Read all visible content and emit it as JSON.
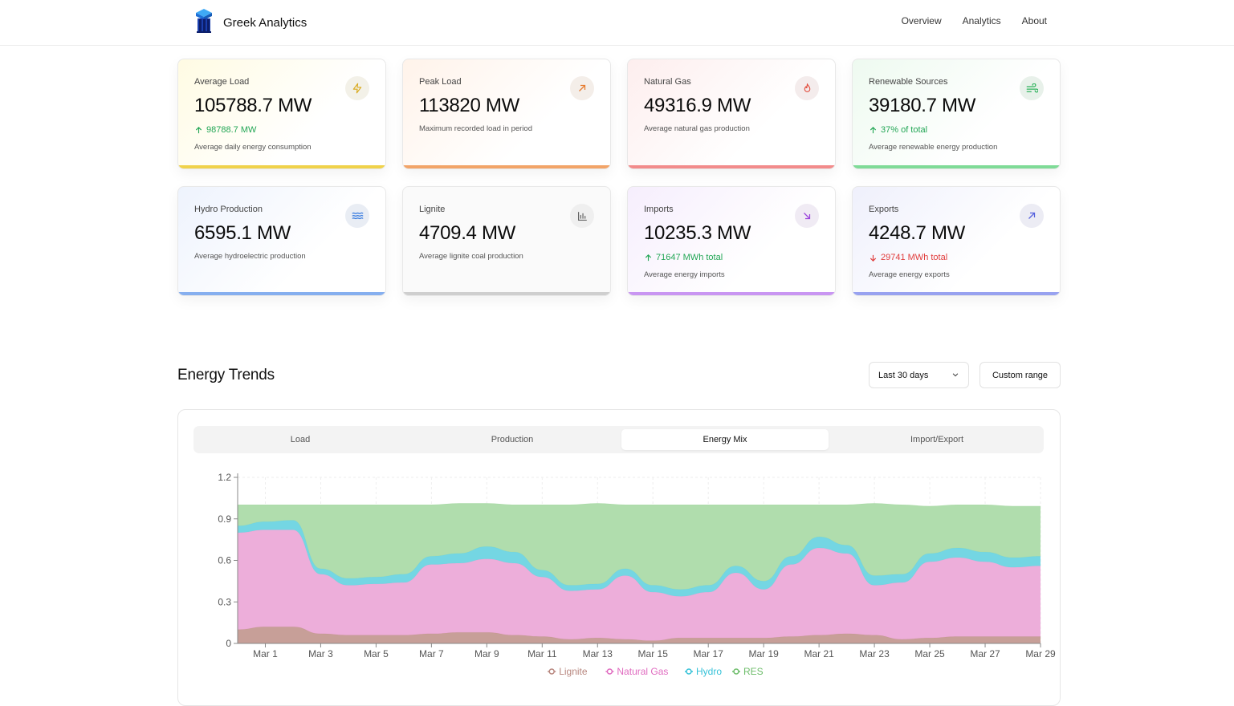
{
  "app": {
    "title": "Greek Analytics"
  },
  "nav": [
    "Overview",
    "Analytics",
    "About"
  ],
  "cards": [
    {
      "title": "Average Load",
      "value": "105788.7 MW",
      "trend": "98788.7 MW",
      "trend_dir": "up",
      "desc": "Average daily energy consumption",
      "icon": "bolt-icon",
      "accent": "#e9c73b"
    },
    {
      "title": "Peak Load",
      "value": "113820 MW",
      "desc": "Maximum recorded load in period",
      "icon": "arrow-up-right-icon",
      "accent": "#ee9a5a"
    },
    {
      "title": "Natural Gas",
      "value": "49316.9 MW",
      "desc": "Average natural gas production",
      "icon": "flame-icon",
      "accent": "#ef7f7f"
    },
    {
      "title": "Renewable Sources",
      "value": "39180.7 MW",
      "trend": "37% of total",
      "trend_dir": "up",
      "desc": "Average renewable energy production",
      "icon": "wind-icon",
      "accent": "#6fd08a"
    },
    {
      "title": "Hydro Production",
      "value": "6595.1 MW",
      "desc": "Average hydroelectric production",
      "icon": "waves-icon",
      "accent": "#7aa8ef"
    },
    {
      "title": "Lignite",
      "value": "4709.4 MW",
      "desc": "Average lignite coal production",
      "icon": "bar-chart-icon",
      "accent": "#c9c9c9"
    },
    {
      "title": "Imports",
      "value": "10235.3 MW",
      "trend": "71647 MWh total",
      "trend_dir": "up",
      "desc": "Average energy imports",
      "icon": "arrow-down-right-icon",
      "accent": "#c08bef"
    },
    {
      "title": "Exports",
      "value": "4248.7 MW",
      "trend": "29741 MWh total",
      "trend_dir": "down",
      "desc": "Average energy exports",
      "icon": "arrow-up-right-icon",
      "accent": "#8d9bef"
    }
  ],
  "section": {
    "title": "Energy Trends",
    "range_select": "Last 30 days",
    "custom_range": "Custom range"
  },
  "tabs": [
    "Load",
    "Production",
    "Energy Mix",
    "Import/Export"
  ],
  "active_tab": "Energy Mix",
  "chart_data": {
    "type": "area",
    "stacked": true,
    "x_ticks": [
      "Mar 1",
      "Mar 3",
      "Mar 5",
      "Mar 7",
      "Mar 9",
      "Mar 11",
      "Mar 13",
      "Mar 15",
      "Mar 17",
      "Mar 19",
      "Mar 21",
      "Mar 23",
      "Mar 25",
      "Mar 27",
      "Mar 29"
    ],
    "y_ticks": [
      "0",
      "0.3",
      "0.6",
      "0.9",
      "1.2"
    ],
    "ylim": [
      0,
      1.2
    ],
    "x": [
      "Feb 29",
      "Mar 1",
      "Mar 2",
      "Mar 3",
      "Mar 4",
      "Mar 5",
      "Mar 6",
      "Mar 7",
      "Mar 8",
      "Mar 9",
      "Mar 10",
      "Mar 11",
      "Mar 12",
      "Mar 13",
      "Mar 14",
      "Mar 15",
      "Mar 16",
      "Mar 17",
      "Mar 18",
      "Mar 19",
      "Mar 20",
      "Mar 21",
      "Mar 22",
      "Mar 23",
      "Mar 24",
      "Mar 25",
      "Mar 26",
      "Mar 27",
      "Mar 28",
      "Mar 29"
    ],
    "legend_position": "bottom",
    "series": [
      {
        "name": "Lignite",
        "color": "#b8877f",
        "fill": "#c49a92",
        "values": [
          0.1,
          0.12,
          0.12,
          0.07,
          0.06,
          0.06,
          0.06,
          0.07,
          0.08,
          0.08,
          0.06,
          0.05,
          0.03,
          0.04,
          0.03,
          0.02,
          0.04,
          0.04,
          0.04,
          0.04,
          0.05,
          0.06,
          0.07,
          0.06,
          0.03,
          0.04,
          0.05,
          0.05,
          0.05,
          0.05
        ]
      },
      {
        "name": "Natural Gas",
        "color": "#e06cc0",
        "fill": "#ecaad8",
        "values": [
          0.7,
          0.7,
          0.7,
          0.43,
          0.36,
          0.37,
          0.38,
          0.5,
          0.5,
          0.53,
          0.52,
          0.43,
          0.35,
          0.35,
          0.46,
          0.35,
          0.3,
          0.33,
          0.47,
          0.35,
          0.52,
          0.63,
          0.58,
          0.36,
          0.41,
          0.55,
          0.57,
          0.54,
          0.5,
          0.51
        ]
      },
      {
        "name": "Hydro",
        "color": "#36c2d8",
        "fill": "#6dd4e2",
        "values": [
          0.05,
          0.06,
          0.07,
          0.04,
          0.05,
          0.05,
          0.06,
          0.06,
          0.07,
          0.09,
          0.08,
          0.05,
          0.04,
          0.04,
          0.05,
          0.05,
          0.05,
          0.05,
          0.05,
          0.06,
          0.06,
          0.08,
          0.06,
          0.07,
          0.06,
          0.06,
          0.07,
          0.07,
          0.07,
          0.07
        ]
      },
      {
        "name": "RES",
        "color": "#6dbd6a",
        "fill": "#acdba9",
        "values": [
          0.15,
          0.12,
          0.11,
          0.46,
          0.53,
          0.52,
          0.5,
          0.37,
          0.36,
          0.31,
          0.34,
          0.47,
          0.58,
          0.58,
          0.46,
          0.58,
          0.61,
          0.58,
          0.44,
          0.55,
          0.37,
          0.23,
          0.29,
          0.52,
          0.5,
          0.34,
          0.31,
          0.34,
          0.37,
          0.36
        ]
      }
    ]
  }
}
